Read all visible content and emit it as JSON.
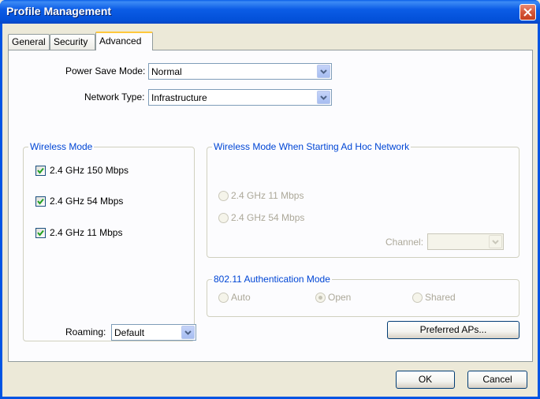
{
  "window": {
    "title": "Profile Management"
  },
  "tabs": [
    {
      "label": "General"
    },
    {
      "label": "Security"
    },
    {
      "label": "Advanced"
    }
  ],
  "power_save": {
    "label": "Power Save Mode:",
    "value": "Normal"
  },
  "network_type": {
    "label": "Network Type:",
    "value": "Infrastructure"
  },
  "wireless_mode": {
    "legend": "Wireless Mode",
    "options": [
      {
        "label": "2.4 GHz 150 Mbps",
        "checked": true
      },
      {
        "label": "2.4 GHz 54 Mbps",
        "checked": true
      },
      {
        "label": "2.4 GHz 11 Mbps",
        "checked": true
      }
    ]
  },
  "adhoc": {
    "legend": "Wireless Mode When Starting Ad Hoc Network",
    "options": [
      {
        "label": "2.4 GHz 11 Mbps"
      },
      {
        "label": "2.4 GHz 54 Mbps"
      }
    ],
    "channel_label": "Channel:",
    "channel_value": ""
  },
  "auth_mode": {
    "legend": "802.11 Authentication Mode",
    "options": [
      {
        "label": "Auto",
        "selected": false
      },
      {
        "label": "Open",
        "selected": true
      },
      {
        "label": "Shared",
        "selected": false
      }
    ]
  },
  "roaming": {
    "label": "Roaming:",
    "value": "Default"
  },
  "buttons": {
    "preferred_aps": "Preferred APs...",
    "ok": "OK",
    "cancel": "Cancel"
  },
  "colors": {
    "titlebar": "#0054e3",
    "legend": "#0046d5",
    "dialog_bg": "#ece9d8",
    "check": "#21a121"
  }
}
